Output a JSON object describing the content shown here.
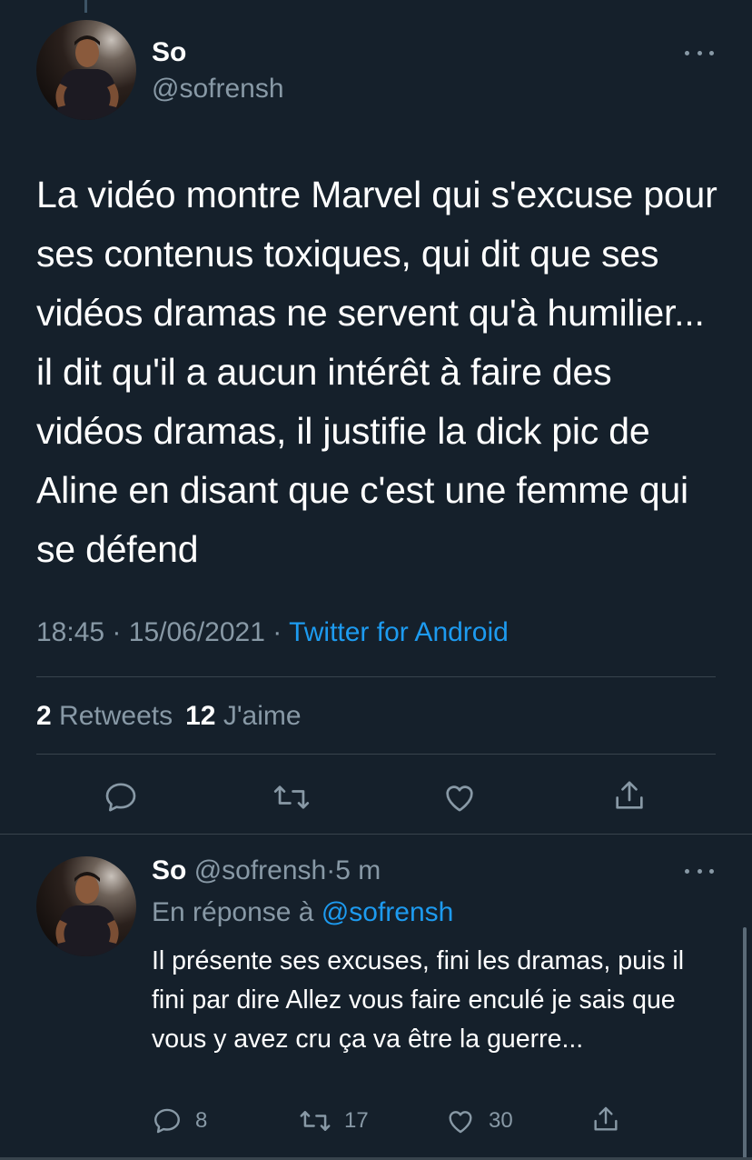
{
  "tweet": {
    "author_name": "So",
    "author_handle": "@sofrensh",
    "text": "La vidéo montre Marvel qui s'excuse pour ses contenus toxiques, qui dit que ses vidéos dramas ne servent qu'à humilier... il dit qu'il a aucun intérêt à faire des vidéos dramas, il justifie la dick pic de Aline en disant que c'est une femme qui se défend",
    "time": "18:45",
    "date": "15/06/2021",
    "separator": "·",
    "source": "Twitter for Android",
    "retweets_count": "2",
    "retweets_label": "Retweets",
    "likes_count": "12",
    "likes_label": "J'aime",
    "actions": [
      "reply-icon",
      "retweet-icon",
      "like-icon",
      "share-icon"
    ]
  },
  "reply": {
    "author_name": "So",
    "author_handle": "@sofrensh",
    "separator": "·",
    "time_ago": "5 m",
    "in_reply_prefix": "En réponse à",
    "in_reply_handle": "@sofrensh",
    "text": "Il présente ses excuses, fini les dramas, puis il fini par dire Allez vous faire enculé je sais que vous y avez cru ça va être la guerre...",
    "reply_count": "8",
    "retweet_count": "17",
    "like_count": "30"
  },
  "colors": {
    "background": "#15202b",
    "text_primary": "#ffffff",
    "text_secondary": "#8899a6",
    "accent": "#1d9bf0",
    "divider": "#38444d"
  }
}
